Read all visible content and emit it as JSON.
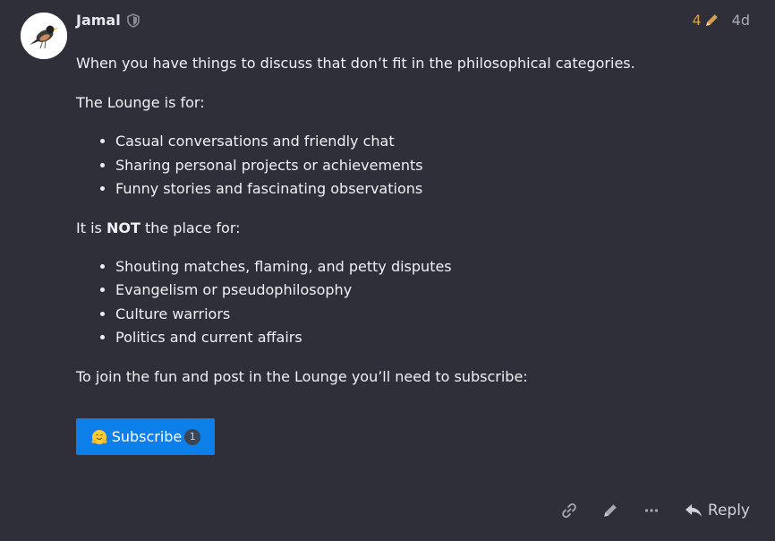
{
  "post": {
    "author": "Jamal",
    "edit_count": "4",
    "age": "4d"
  },
  "content": {
    "intro": "When you have things to discuss that don’t fit in the philosophical categories.",
    "lounge_for": "The Lounge is for:",
    "for_items": [
      "Casual conversations and friendly chat",
      "Sharing personal projects or achievements",
      "Funny stories and fascinating observations"
    ],
    "not_prefix": "It is ",
    "not_word": "NOT",
    "not_suffix": " the place for:",
    "not_items": [
      "Shouting matches, flaming, and petty disputes",
      "Evangelism or pseudophilosophy",
      "Culture warriors",
      "Politics and current affairs"
    ],
    "join": "To join the fun and post in the Lounge you’ll need to subscribe:"
  },
  "subscribe": {
    "label": "Subscribe",
    "count": "1"
  },
  "actions": {
    "reply_label": "Reply"
  },
  "icons": {
    "moderator": "shield-icon",
    "edit": "pencil-icon",
    "link": "link-icon",
    "more": "ellipsis-icon",
    "reply": "reply-icon",
    "emoji": "hugging-face-emoji"
  },
  "colors": {
    "background": "#2f2f3a",
    "accent": "#0d7fe8",
    "edit_highlight": "#d4a04c"
  }
}
